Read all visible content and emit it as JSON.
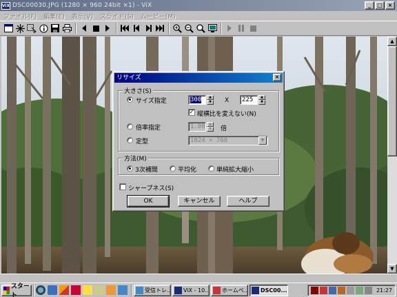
{
  "window": {
    "title": "DSC00030.JPG (1280 × 960 24bit ×1) - ViX",
    "app_icon": "ViX",
    "min": "_",
    "max": "□",
    "close": "×"
  },
  "menu": [
    "ファイル(F)",
    "編集(E)",
    "表示(V)",
    "スライド(S)",
    "ムービー(M)"
  ],
  "toolbar_icons": [
    "window-icon",
    "sparkle-icon",
    "select-icon",
    "info-icon",
    "save-icon",
    "print-icon",
    "prev-icon",
    "stop-icon",
    "play-icon",
    "first-icon",
    "back-icon",
    "forward-icon",
    "last-icon",
    "zoom-in-icon",
    "zoom-out-icon",
    "zoom-fit-icon",
    "monitor-icon",
    "movie-play-icon",
    "movie-pause-icon",
    "movie-stop-icon"
  ],
  "dialog": {
    "title": "リサイズ",
    "close": "×",
    "size_group": "大きさ(S)",
    "size_spec_label": "サイズ指定",
    "width_value": "300",
    "x_label": "X",
    "height_value": "225",
    "keep_ratio_label": "縦横比を変えない(N)",
    "keep_ratio_checked": true,
    "ratio_label": "倍率指定",
    "ratio_value": "1.00",
    "ratio_unit": "倍",
    "fixed_label": "定型",
    "fixed_value": "1024 × 768",
    "method_group": "方法(M)",
    "method_bicubic": "3次補間",
    "method_average": "平均化",
    "method_simple": "単純拡大縮小",
    "sharpness_label": "シャープネス(S)",
    "ok_label": "OK",
    "cancel_label": "キャンセル",
    "help_label": "ヘルプ"
  },
  "taskbar": {
    "start_label": "スタート",
    "tasks": [
      {
        "label": "受信トレ...",
        "active": false
      },
      {
        "label": "ViX - 10...",
        "active": false
      },
      {
        "label": "ホームペ...",
        "active": false
      },
      {
        "label": "DSC00...",
        "active": true
      }
    ],
    "clock": "21:27"
  }
}
